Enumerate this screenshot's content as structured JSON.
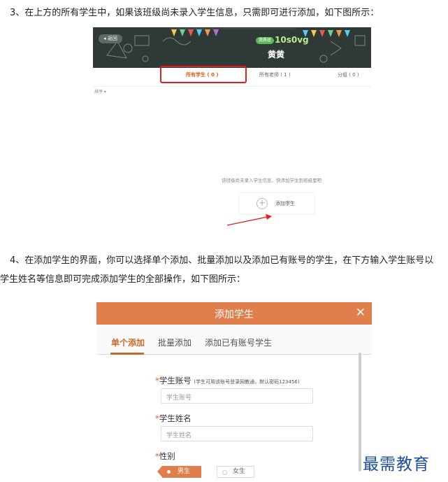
{
  "doc": {
    "step3": "3、在上方的所有学生中，如果该班级尚未录入学生信息，只需即可进行添加，如下图所示：",
    "step4_line1": "4、在添加学生的界面，你可以选择单个添加、批量添加以及添加已有账号的学生，在下方输入学生账号以",
    "step4_line2": "学生姓名等信息即可完成添加学生的全部操作，如下图所示："
  },
  "screenshot1": {
    "back_label": "返回",
    "grade_badge": "资质班",
    "class_code": "10s0vg",
    "teacher_name": "黄黄",
    "tabs": [
      "所有学生 ( 0 )",
      "所有老师 ( 1 )",
      "分组 ( 0 )"
    ],
    "sort_label": "排序 ▾",
    "empty_hint": "该班级尚未录入学生信息，快添加学生到班级里吧",
    "add_student_label": "添加学生",
    "colors": {
      "highlight": "#e02020",
      "banner": "#2f3a36",
      "active_tab": "#e05a10"
    }
  },
  "dialog": {
    "title": "添加学生",
    "close_icon": "close-icon",
    "modes": [
      "单个添加",
      "批量添加",
      "添加已有账号学生"
    ],
    "account_label": "学生账号",
    "account_note": "(学生可用该账号登录网教通，默认密码123456)",
    "account_placeholder": "学生账号",
    "name_label": "学生姓名",
    "name_placeholder": "学生姓名",
    "gender_label": "性别",
    "gender_male": "男生",
    "gender_female": "女生",
    "required_mark": "*",
    "colors": {
      "header": "#e07f4c",
      "active_mode": "#c96a28"
    }
  },
  "watermark": "最需教育"
}
